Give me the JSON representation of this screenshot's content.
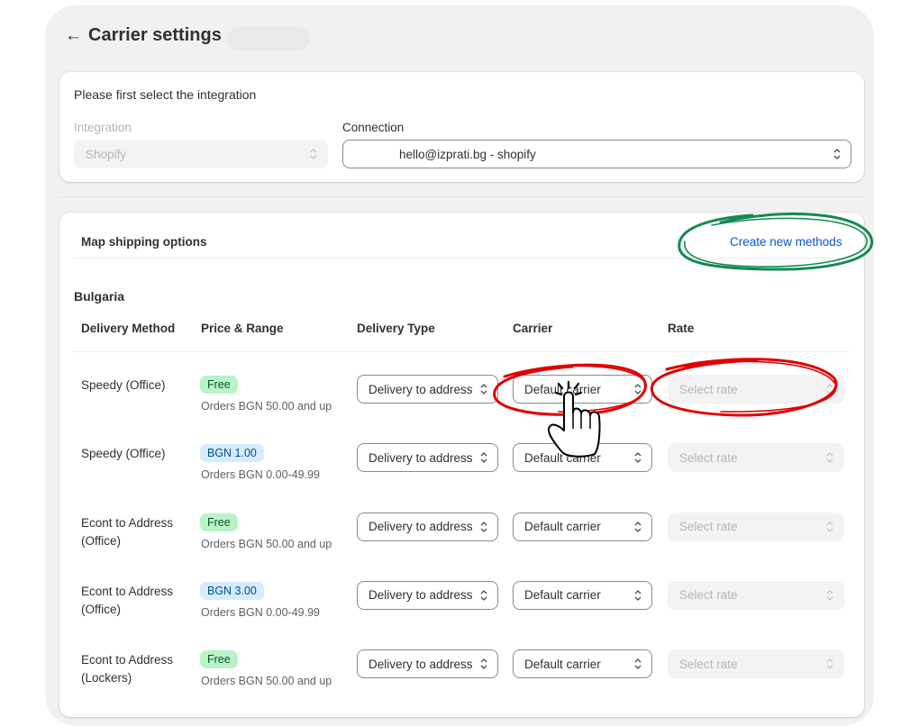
{
  "header": {
    "title": "Carrier settings",
    "back_icon": "arrow-left-icon"
  },
  "integration_card": {
    "prompt": "Please first select the integration",
    "integration": {
      "label": "Integration",
      "value": "Shopify",
      "disabled": true
    },
    "connection": {
      "label": "Connection",
      "value": "hello@izprati.bg - shopify"
    }
  },
  "mapping": {
    "title": "Map shipping options",
    "create_link": "Create new methods",
    "country": "Bulgaria",
    "columns": [
      "Delivery Method",
      "Price & Range",
      "Delivery Type",
      "Carrier",
      "Rate"
    ],
    "rows": [
      {
        "method": [
          "Speedy (Office)"
        ],
        "price": "Free",
        "price_kind": "free",
        "range": "Orders BGN 50.00 and up",
        "delivery_type": "Delivery to address",
        "carrier": "Default carrier",
        "rate": "Select rate"
      },
      {
        "method": [
          "Speedy (Office)"
        ],
        "price": "BGN 1.00",
        "price_kind": "paid",
        "range": "Orders BGN 0.00-49.99",
        "delivery_type": "Delivery to address",
        "carrier": "Default carrier",
        "rate": "Select rate"
      },
      {
        "method": [
          "Econt to Address",
          "(Office)"
        ],
        "price": "Free",
        "price_kind": "free",
        "range": "Orders BGN 50.00 and up",
        "delivery_type": "Delivery to address",
        "carrier": "Default carrier",
        "rate": "Select rate"
      },
      {
        "method": [
          "Econt to Address",
          "(Office)"
        ],
        "price": "BGN 3.00",
        "price_kind": "paid",
        "range": "Orders BGN 0.00-49.99",
        "delivery_type": "Delivery to address",
        "carrier": "Default carrier",
        "rate": "Select rate"
      },
      {
        "method": [
          "Econt to Address",
          "(Lockers)"
        ],
        "price": "Free",
        "price_kind": "free",
        "range": "Orders BGN 50.00 and up",
        "delivery_type": "Delivery to address",
        "carrier": "Default carrier",
        "rate": "Select rate"
      }
    ]
  },
  "annotations": {
    "green_circle": "#138a52",
    "red_scribble": "#e00000",
    "cursor_icon": "hand-pointer-icon"
  }
}
